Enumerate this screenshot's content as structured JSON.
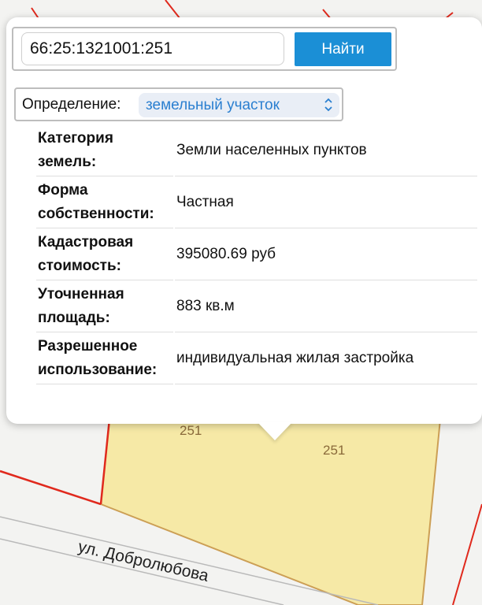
{
  "search": {
    "value": "66:25:1321001:251",
    "button_label": "Найти"
  },
  "definition": {
    "label": "Определение:",
    "selected": "земельный участок"
  },
  "info_rows": [
    {
      "key_line1": "Категория",
      "key_line2": "земель",
      "value": "Земли населенных пунктов"
    },
    {
      "key_line1": "Форма",
      "key_line2": "собственности",
      "value": "Частная"
    },
    {
      "key_line1": "Кадастровая",
      "key_line2": "стоимость",
      "value": "395080.69 руб"
    },
    {
      "key_line1": "Уточненная",
      "key_line2": "площадь",
      "value": "883 кв.м"
    },
    {
      "key_line1": "Разрешенное",
      "key_line2": "использование",
      "value": "индивидуальная жилая застройка"
    }
  ],
  "map": {
    "parcel_labels": [
      "251",
      "251"
    ],
    "street_name": "ул. Добролюбова",
    "colors": {
      "parcel_fill": "#f6e9a6",
      "parcel_border": "#cc9f55",
      "boundary_red": "#e0291d",
      "accent_blue": "#1b8fd6"
    }
  }
}
